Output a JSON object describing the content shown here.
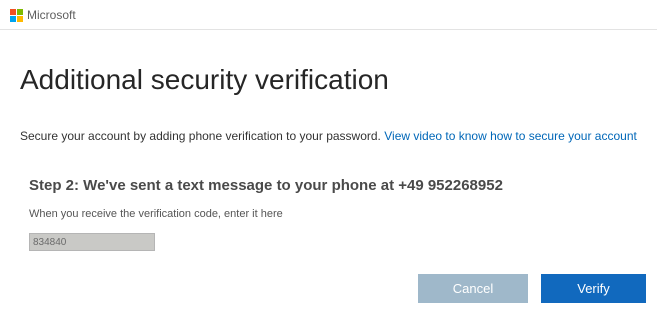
{
  "header": {
    "brand": "Microsoft",
    "logo_colors": [
      "#f25022",
      "#7fba00",
      "#00a4ef",
      "#ffb900"
    ]
  },
  "main": {
    "title": "Additional security verification",
    "intro_text": "Secure your account by adding phone verification to your password.",
    "intro_link": "View video to know how to secure your account",
    "step_heading": "Step 2: We've sent a text message to your phone at +49 952268952",
    "code_label": "When you receive the verification code, enter it here",
    "code_value": "834840"
  },
  "actions": {
    "cancel_label": "Cancel",
    "verify_label": "Verify"
  },
  "colors": {
    "link": "#0067b8",
    "verify_button": "#1169be",
    "cancel_button": "#9fb8ca"
  }
}
